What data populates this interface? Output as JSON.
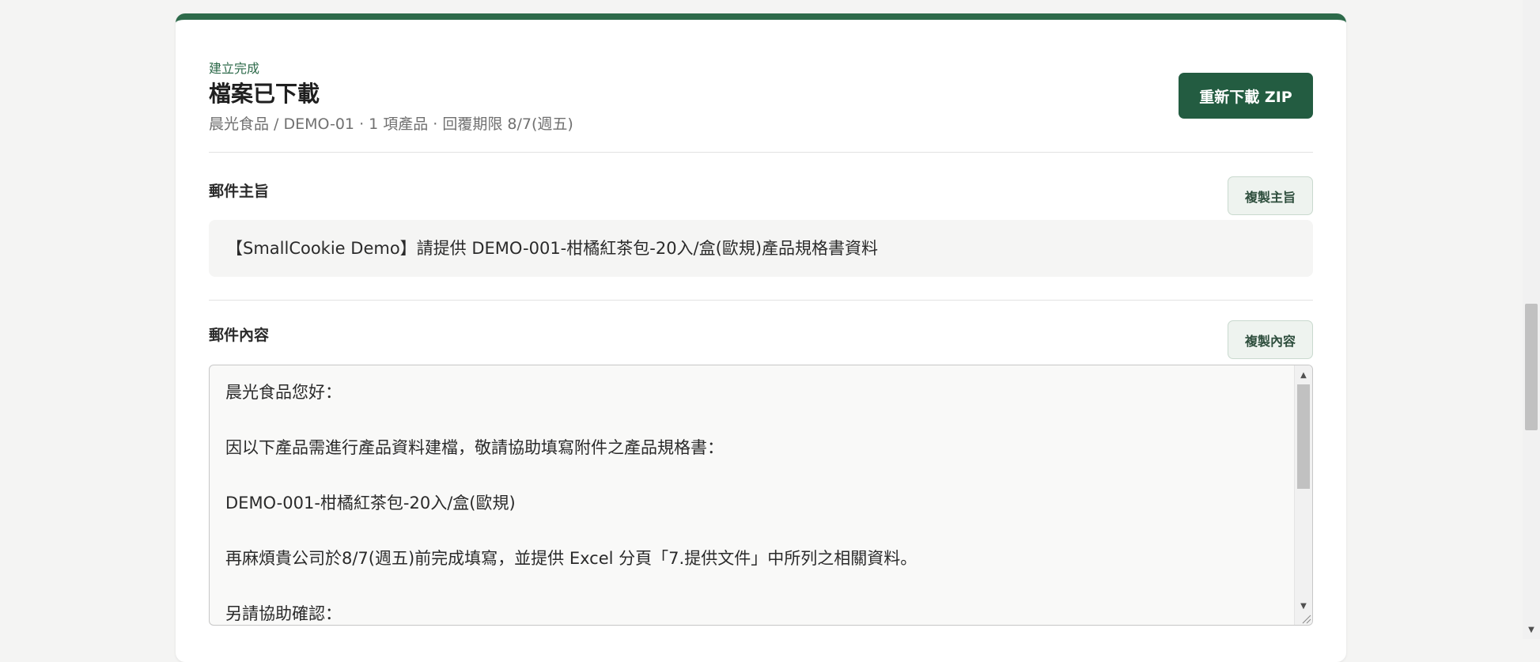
{
  "header": {
    "status_label": "建立完成",
    "title": "檔案已下載",
    "meta": "晨光食品 / DEMO-01 · 1 項產品 · 回覆期限 8/7(週五)",
    "redownload_label": "重新下載 ZIP"
  },
  "subject": {
    "label": "郵件主旨",
    "copy_label": "複製主旨",
    "value": "【SmallCookie Demo】請提供 DEMO-001-柑橘紅茶包-20入/盒(歐規)產品規格書資料"
  },
  "body": {
    "label": "郵件內容",
    "copy_label": "複製內容",
    "lines": [
      "晨光食品您好：",
      "因以下產品需進行產品資料建檔，敬請協助填寫附件之產品規格書：",
      "DEMO-001-柑橘紅茶包-20入/盒(歐規)",
      "再麻煩貴公司於8/7(週五)前完成填寫，並提供 Excel 分頁「7.提供文件」中所列之相關資料。",
      "另請協助確認："
    ]
  },
  "colors": {
    "accent": "#2d6a4a",
    "primary_button": "#235c41",
    "secondary_button_bg": "#eef3ef"
  }
}
